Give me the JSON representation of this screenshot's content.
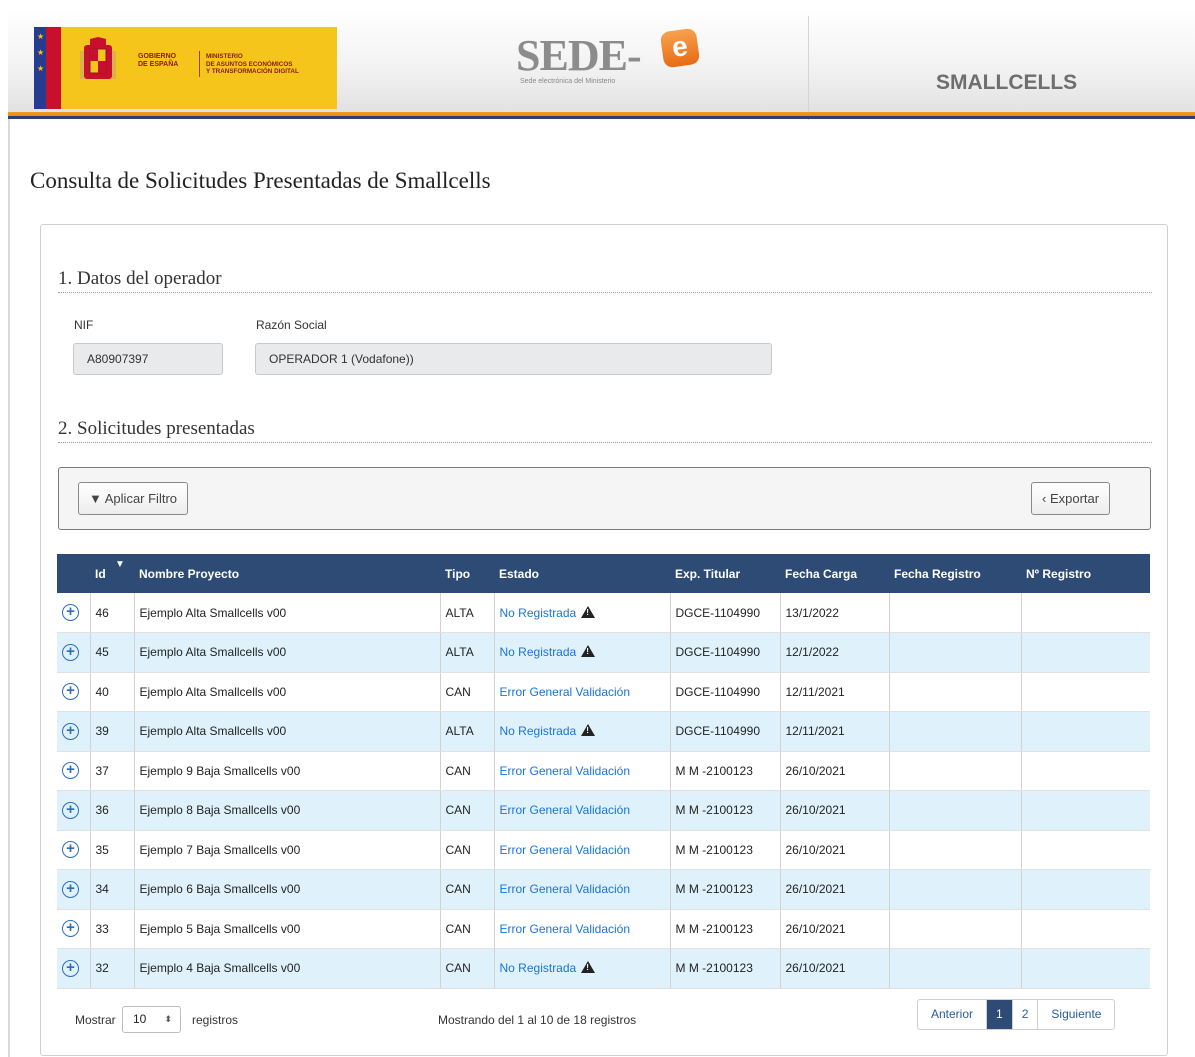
{
  "header": {
    "gov_line1": "GOBIERNO",
    "gov_line2": "DE ESPAÑA",
    "ministry_line1": "MINISTERIO",
    "ministry_line2": "DE ASUNTOS ECONÓMICOS",
    "ministry_line3": "Y TRANSFORMACIÓN DIGITAL",
    "sede_word": "SEDE-",
    "sede_e": "e",
    "sede_subtitle": "Sede electrónica del Ministerio",
    "app_name": "SMALLCELLS"
  },
  "page": {
    "title": "Consulta de Solicitudes Presentadas de Smallcells"
  },
  "operator": {
    "section_title": "1. Datos del operador",
    "nif_label": "NIF",
    "nif_value": "A80907397",
    "razon_label": "Razón Social",
    "razon_value": "OPERADOR 1 (Vodafone))"
  },
  "requests": {
    "section_title": "2. Solicitudes presentadas",
    "filter_button": "▼ Aplicar Filtro",
    "export_button": "‹ Exportar",
    "columns": [
      "Id",
      "Nombre Proyecto",
      "Tipo",
      "Estado",
      "Exp. Titular",
      "Fecha Carga",
      "Fecha Registro",
      "Nº Registro"
    ],
    "rows": [
      {
        "id": "46",
        "nombre": "Ejemplo Alta Smallcells v00",
        "tipo": "ALTA",
        "estado": "No Registrada",
        "warning": true,
        "exp": "DGCE-1104990",
        "fecha_carga": "13/1/2022",
        "fecha_registro": "",
        "n_registro": ""
      },
      {
        "id": "45",
        "nombre": "Ejemplo Alta Smallcells v00",
        "tipo": "ALTA",
        "estado": "No Registrada",
        "warning": true,
        "exp": "DGCE-1104990",
        "fecha_carga": "12/1/2022",
        "fecha_registro": "",
        "n_registro": ""
      },
      {
        "id": "40",
        "nombre": "Ejemplo Alta Smallcells v00",
        "tipo": "CAN",
        "estado": "Error General Validación",
        "warning": false,
        "exp": "DGCE-1104990",
        "fecha_carga": "12/11/2021",
        "fecha_registro": "",
        "n_registro": ""
      },
      {
        "id": "39",
        "nombre": "Ejemplo Alta Smallcells v00",
        "tipo": "ALTA",
        "estado": "No Registrada",
        "warning": true,
        "exp": "DGCE-1104990",
        "fecha_carga": "12/11/2021",
        "fecha_registro": "",
        "n_registro": ""
      },
      {
        "id": "37",
        "nombre": "Ejemplo 9 Baja Smallcells v00",
        "tipo": "CAN",
        "estado": "Error General Validación",
        "warning": false,
        "exp": "M M -2100123",
        "fecha_carga": "26/10/2021",
        "fecha_registro": "",
        "n_registro": ""
      },
      {
        "id": "36",
        "nombre": "Ejemplo 8 Baja Smallcells v00",
        "tipo": "CAN",
        "estado": "Error General Validación",
        "warning": false,
        "exp": "M M -2100123",
        "fecha_carga": "26/10/2021",
        "fecha_registro": "",
        "n_registro": ""
      },
      {
        "id": "35",
        "nombre": "Ejemplo 7 Baja Smallcells v00",
        "tipo": "CAN",
        "estado": "Error General Validación",
        "warning": false,
        "exp": "M M -2100123",
        "fecha_carga": "26/10/2021",
        "fecha_registro": "",
        "n_registro": ""
      },
      {
        "id": "34",
        "nombre": "Ejemplo 6 Baja Smallcells v00",
        "tipo": "CAN",
        "estado": "Error General Validación",
        "warning": false,
        "exp": "M M -2100123",
        "fecha_carga": "26/10/2021",
        "fecha_registro": "",
        "n_registro": ""
      },
      {
        "id": "33",
        "nombre": "Ejemplo 5 Baja Smallcells v00",
        "tipo": "CAN",
        "estado": "Error General Validación",
        "warning": false,
        "exp": "M M -2100123",
        "fecha_carga": "26/10/2021",
        "fecha_registro": "",
        "n_registro": ""
      },
      {
        "id": "32",
        "nombre": "Ejemplo 4 Baja Smallcells v00",
        "tipo": "CAN",
        "estado": "No Registrada",
        "warning": true,
        "exp": "M M -2100123",
        "fecha_carga": "26/10/2021",
        "fecha_registro": "",
        "n_registro": ""
      }
    ]
  },
  "footer": {
    "show_label": "Mostrar",
    "page_size": "10",
    "records_label": "registros",
    "info": "Mostrando del 1 al 10 de 18 registros",
    "prev": "Anterior",
    "pages": [
      "1",
      "2"
    ],
    "next": "Siguiente"
  },
  "colors": {
    "header_blue": "#2d4b75",
    "row_alt": "#dff2fb",
    "link_blue": "#1a73d9",
    "accent_orange": "#f29a1e"
  }
}
